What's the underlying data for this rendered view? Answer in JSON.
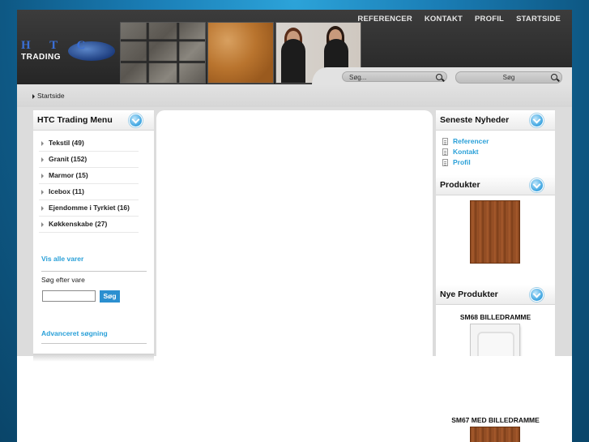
{
  "header": {
    "logo_top": "H T C",
    "logo_bottom": "TRADING",
    "nav": [
      "REFERENCER",
      "KONTAKT",
      "PROFIL",
      "STARTSIDE"
    ],
    "search_placeholder": "Søg...",
    "search_button_label": "Søg"
  },
  "breadcrumb": {
    "label": "Startside"
  },
  "left_menu": {
    "title": "HTC Trading Menu",
    "items": [
      "Tekstil (49)",
      "Granit (152)",
      "Marmor (15)",
      "Icebox (11)",
      "Ejendomme i Tyrkiet (16)",
      "Køkkenskabe (27)"
    ],
    "view_all": "Vis alle varer",
    "search_label": "Søg efter vare",
    "search_button": "Søg",
    "advanced": "Advanceret søgning"
  },
  "right": {
    "news_title": "Seneste Nyheder",
    "news_items": [
      "Referencer",
      "Kontakt",
      "Profil"
    ],
    "products_title": "Produkter",
    "new_products_title": "Nye Produkter",
    "new_products": [
      "SM68 BILLEDRAMME",
      "SM67 MED BILLEDRAMME"
    ]
  },
  "icons": [
    "search-icon",
    "chevron-down-icon",
    "document-icon",
    "arrow-right-icon"
  ]
}
